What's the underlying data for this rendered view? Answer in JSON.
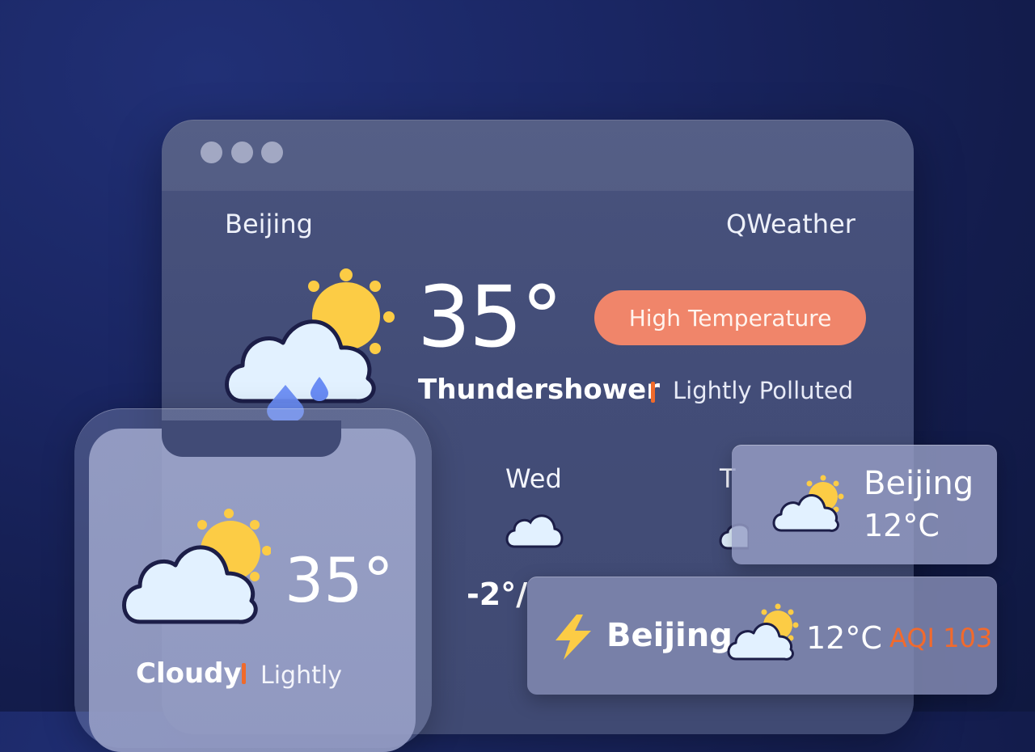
{
  "main": {
    "location": "Beijing",
    "brand": "QWeather",
    "temperature": "35°",
    "alert": "High Temperature",
    "condition": "Thundershower",
    "air_quality": "Lightly Polluted",
    "forecast": [
      {
        "day": "Wed",
        "low": "-2°/",
        "icon": "cloud-icon"
      },
      {
        "day": "T",
        "icon": "cloud-icon"
      }
    ],
    "weather_icon": "partly-cloudy-rain-icon"
  },
  "phone": {
    "temperature": "35°",
    "condition": "Cloudy",
    "air_quality": "Lightly",
    "weather_icon": "partly-cloudy-icon"
  },
  "widget_small": {
    "location": "Beijing",
    "temperature": "12°C",
    "weather_icon": "partly-cloudy-icon"
  },
  "widget_wide": {
    "location": "Beijing",
    "temperature": "12°C",
    "aqi": "AQI 103",
    "alert_icon": "lightning-icon",
    "weather_icon": "partly-cloudy-icon"
  },
  "colors": {
    "background": "#172257",
    "alert_pill": "#f0856a",
    "accent_orange": "#f06a2a",
    "sun": "#fccc45",
    "cloud_fill": "#e2f1ff",
    "cloud_outline": "#1c1e48",
    "rain": "#6a8df5"
  }
}
